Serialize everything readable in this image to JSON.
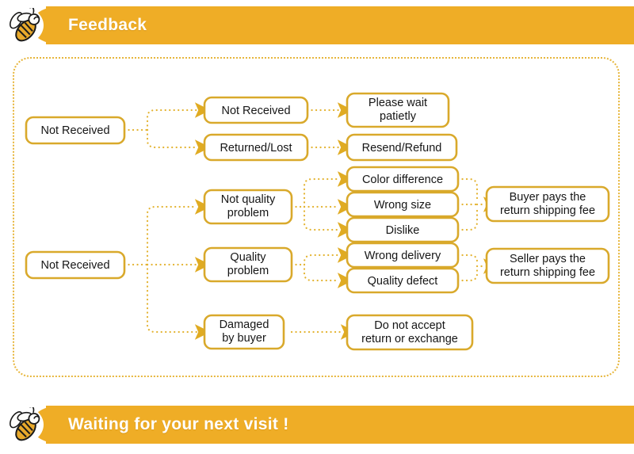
{
  "header": {
    "title": "Feedback",
    "icon": "bee-icon",
    "background_color": "#efad26",
    "text_color": "#ffffff"
  },
  "footer": {
    "title": "Waiting for your next visit !",
    "icon": "bee-icon",
    "background_color": "#efad26",
    "text_color": "#ffffff"
  },
  "panel": {
    "border_color": "#e7b63c",
    "border_style": "dotted"
  },
  "flowchart": {
    "node_border_color": "#d9a92b",
    "node_fill_color": "#ffffff",
    "connector_color": "#e3b331",
    "nodes": {
      "root_not_received_top": "Not Received",
      "root_not_received_bottom": "Not Received",
      "branch_not_received": "Not Received",
      "branch_returned_lost": "Returned/Lost",
      "result_please_wait_line1": "Please wait",
      "result_please_wait_line2": "patietly",
      "result_resend_refund": "Resend/Refund",
      "cat_not_quality_line1": "Not quality",
      "cat_not_quality_line2": "problem",
      "cat_quality_line1": "Quality",
      "cat_quality_line2": "problem",
      "cat_damaged_line1": "Damaged",
      "cat_damaged_line2": "by buyer",
      "reason_color_difference": "Color difference",
      "reason_wrong_size": "Wrong size",
      "reason_dislike": "Dislike",
      "reason_wrong_delivery": "Wrong delivery",
      "reason_quality_defect": "Quality defect",
      "outcome_buyer_line1": "Buyer pays the",
      "outcome_buyer_line2": "return shipping fee",
      "outcome_seller_line1": "Seller pays the",
      "outcome_seller_line2": "return shipping fee",
      "outcome_no_return_line1": "Do not accept",
      "outcome_no_return_line2": "return or exchange"
    }
  }
}
